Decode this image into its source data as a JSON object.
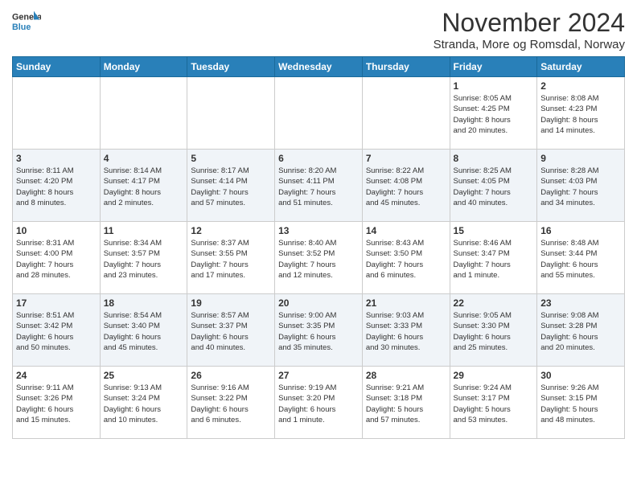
{
  "logo": {
    "line1": "General",
    "line2": "Blue"
  },
  "title": "November 2024",
  "subtitle": "Stranda, More og Romsdal, Norway",
  "header": {
    "colors": {
      "blue": "#2980b9"
    }
  },
  "weekdays": [
    "Sunday",
    "Monday",
    "Tuesday",
    "Wednesday",
    "Thursday",
    "Friday",
    "Saturday"
  ],
  "weeks": [
    {
      "cells": [
        {
          "day": "",
          "info": ""
        },
        {
          "day": "",
          "info": ""
        },
        {
          "day": "",
          "info": ""
        },
        {
          "day": "",
          "info": ""
        },
        {
          "day": "",
          "info": ""
        },
        {
          "day": "1",
          "info": "Sunrise: 8:05 AM\nSunset: 4:25 PM\nDaylight: 8 hours\nand 20 minutes."
        },
        {
          "day": "2",
          "info": "Sunrise: 8:08 AM\nSunset: 4:23 PM\nDaylight: 8 hours\nand 14 minutes."
        }
      ]
    },
    {
      "cells": [
        {
          "day": "3",
          "info": "Sunrise: 8:11 AM\nSunset: 4:20 PM\nDaylight: 8 hours\nand 8 minutes."
        },
        {
          "day": "4",
          "info": "Sunrise: 8:14 AM\nSunset: 4:17 PM\nDaylight: 8 hours\nand 2 minutes."
        },
        {
          "day": "5",
          "info": "Sunrise: 8:17 AM\nSunset: 4:14 PM\nDaylight: 7 hours\nand 57 minutes."
        },
        {
          "day": "6",
          "info": "Sunrise: 8:20 AM\nSunset: 4:11 PM\nDaylight: 7 hours\nand 51 minutes."
        },
        {
          "day": "7",
          "info": "Sunrise: 8:22 AM\nSunset: 4:08 PM\nDaylight: 7 hours\nand 45 minutes."
        },
        {
          "day": "8",
          "info": "Sunrise: 8:25 AM\nSunset: 4:05 PM\nDaylight: 7 hours\nand 40 minutes."
        },
        {
          "day": "9",
          "info": "Sunrise: 8:28 AM\nSunset: 4:03 PM\nDaylight: 7 hours\nand 34 minutes."
        }
      ]
    },
    {
      "cells": [
        {
          "day": "10",
          "info": "Sunrise: 8:31 AM\nSunset: 4:00 PM\nDaylight: 7 hours\nand 28 minutes."
        },
        {
          "day": "11",
          "info": "Sunrise: 8:34 AM\nSunset: 3:57 PM\nDaylight: 7 hours\nand 23 minutes."
        },
        {
          "day": "12",
          "info": "Sunrise: 8:37 AM\nSunset: 3:55 PM\nDaylight: 7 hours\nand 17 minutes."
        },
        {
          "day": "13",
          "info": "Sunrise: 8:40 AM\nSunset: 3:52 PM\nDaylight: 7 hours\nand 12 minutes."
        },
        {
          "day": "14",
          "info": "Sunrise: 8:43 AM\nSunset: 3:50 PM\nDaylight: 7 hours\nand 6 minutes."
        },
        {
          "day": "15",
          "info": "Sunrise: 8:46 AM\nSunset: 3:47 PM\nDaylight: 7 hours\nand 1 minute."
        },
        {
          "day": "16",
          "info": "Sunrise: 8:48 AM\nSunset: 3:44 PM\nDaylight: 6 hours\nand 55 minutes."
        }
      ]
    },
    {
      "cells": [
        {
          "day": "17",
          "info": "Sunrise: 8:51 AM\nSunset: 3:42 PM\nDaylight: 6 hours\nand 50 minutes."
        },
        {
          "day": "18",
          "info": "Sunrise: 8:54 AM\nSunset: 3:40 PM\nDaylight: 6 hours\nand 45 minutes."
        },
        {
          "day": "19",
          "info": "Sunrise: 8:57 AM\nSunset: 3:37 PM\nDaylight: 6 hours\nand 40 minutes."
        },
        {
          "day": "20",
          "info": "Sunrise: 9:00 AM\nSunset: 3:35 PM\nDaylight: 6 hours\nand 35 minutes."
        },
        {
          "day": "21",
          "info": "Sunrise: 9:03 AM\nSunset: 3:33 PM\nDaylight: 6 hours\nand 30 minutes."
        },
        {
          "day": "22",
          "info": "Sunrise: 9:05 AM\nSunset: 3:30 PM\nDaylight: 6 hours\nand 25 minutes."
        },
        {
          "day": "23",
          "info": "Sunrise: 9:08 AM\nSunset: 3:28 PM\nDaylight: 6 hours\nand 20 minutes."
        }
      ]
    },
    {
      "cells": [
        {
          "day": "24",
          "info": "Sunrise: 9:11 AM\nSunset: 3:26 PM\nDaylight: 6 hours\nand 15 minutes."
        },
        {
          "day": "25",
          "info": "Sunrise: 9:13 AM\nSunset: 3:24 PM\nDaylight: 6 hours\nand 10 minutes."
        },
        {
          "day": "26",
          "info": "Sunrise: 9:16 AM\nSunset: 3:22 PM\nDaylight: 6 hours\nand 6 minutes."
        },
        {
          "day": "27",
          "info": "Sunrise: 9:19 AM\nSunset: 3:20 PM\nDaylight: 6 hours\nand 1 minute."
        },
        {
          "day": "28",
          "info": "Sunrise: 9:21 AM\nSunset: 3:18 PM\nDaylight: 5 hours\nand 57 minutes."
        },
        {
          "day": "29",
          "info": "Sunrise: 9:24 AM\nSunset: 3:17 PM\nDaylight: 5 hours\nand 53 minutes."
        },
        {
          "day": "30",
          "info": "Sunrise: 9:26 AM\nSunset: 3:15 PM\nDaylight: 5 hours\nand 48 minutes."
        }
      ]
    }
  ]
}
